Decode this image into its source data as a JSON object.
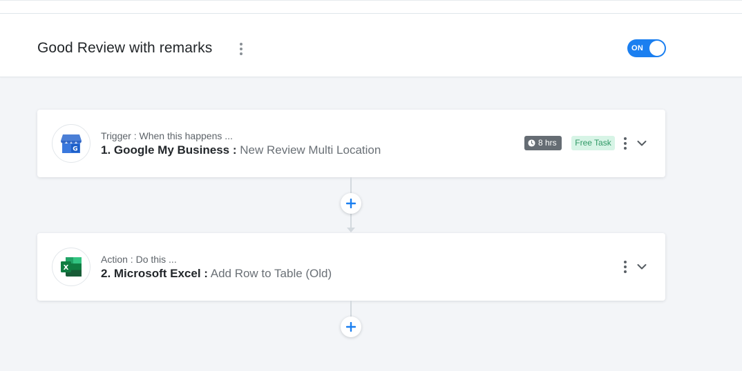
{
  "workflow": {
    "title": "Good Review with remarks",
    "toggle_label": "ON"
  },
  "steps": [
    {
      "label": "Trigger : When this happens ...",
      "app": "1. Google My Business :",
      "event": "New Review Multi Location",
      "icon": "google-my-business-icon",
      "time_badge": "8 hrs",
      "task_badge": "Free Task"
    },
    {
      "label": "Action : Do this ...",
      "app": "2. Microsoft Excel :",
      "event": "Add Row to Table (Old)",
      "icon": "microsoft-excel-icon"
    }
  ],
  "colors": {
    "accent": "#1b7ff0",
    "background": "#f3f5f8",
    "time_badge": "#656c73",
    "free_badge_bg": "#d7f4e6",
    "free_badge_text": "#2f9865"
  }
}
